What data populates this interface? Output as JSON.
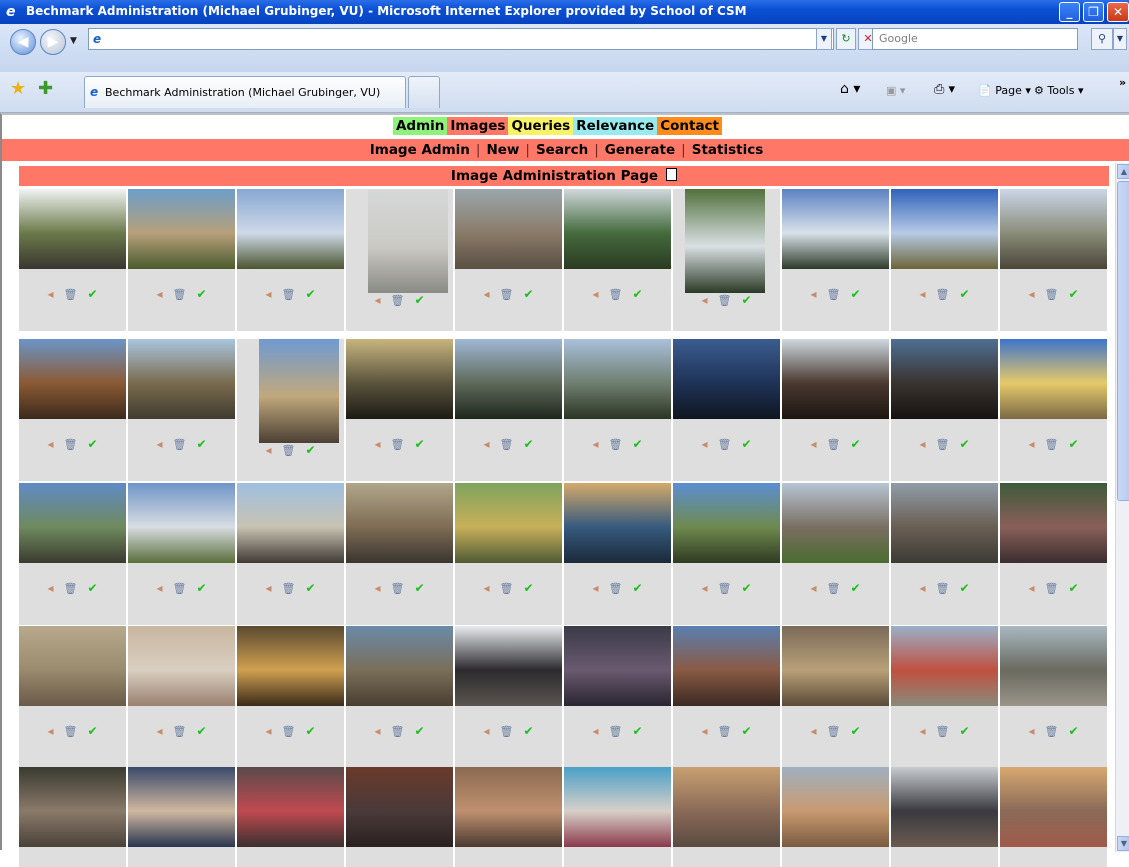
{
  "window": {
    "title": "Bechmark Administration (Michael Grubinger, VU) - Microsoft Internet Explorer provided by School of CSM"
  },
  "addressbar": {
    "url": "",
    "search_placeholder": "Google"
  },
  "tab": {
    "label": "Bechmark Administration (Michael Grubinger, VU)"
  },
  "toolbar": {
    "page_label": "Page",
    "tools_label": "Tools"
  },
  "nav": {
    "admin": "Admin",
    "images": "Images",
    "queries": "Queries",
    "relevance": "Relevance",
    "contact": "Contact"
  },
  "subnav": {
    "image_admin": "Image Admin",
    "new": "New",
    "search": "Search",
    "generate": "Generate",
    "statistics": "Statistics"
  },
  "page": {
    "heading": "Image Administration Page"
  },
  "colors": {
    "images_tab": "#ff7766",
    "admin_tab": "#8ef27a",
    "queries_tab": "#f7f266",
    "relevance_tab": "#99eaef",
    "contact_tab": "#ff8c1a",
    "cell_bg": "#dedede"
  },
  "icons": {
    "edit": "pencil-icon",
    "delete": "trash-icon",
    "ok": "checkmark-icon"
  },
  "images": [
    {
      "scene": "colonial-palace",
      "top": "#f1f3f4",
      "mid": "#6b7a4a",
      "bot": "#3a3530",
      "orient": "land"
    },
    {
      "scene": "colonial-street-palms",
      "top": "#6d9ec9",
      "mid": "#b6a07a",
      "bot": "#4b5b2d",
      "orient": "land"
    },
    {
      "scene": "christ-statue-hill",
      "top": "#87a7d2",
      "mid": "#cfd9e9",
      "bot": "#4a5530",
      "orient": "land"
    },
    {
      "scene": "white-statue",
      "top": "#d6d8d8",
      "mid": "#cbcac5",
      "bot": "#8b8b86",
      "orient": "portrait"
    },
    {
      "scene": "city-aerial",
      "top": "#9aa7ad",
      "mid": "#8a7a68",
      "bot": "#5a4f44",
      "orient": "land"
    },
    {
      "scene": "waterfalls",
      "top": "#d0d8dc",
      "mid": "#446b3d",
      "bot": "#2b3a22",
      "orient": "land"
    },
    {
      "scene": "waterfall-person",
      "top": "#52703c",
      "mid": "#d9e0e4",
      "bot": "#2b3a26",
      "orient": "portrait2"
    },
    {
      "scene": "waterfall-mist",
      "top": "#5c82c2",
      "mid": "#d9e2ea",
      "bot": "#2e3a2a",
      "orient": "land"
    },
    {
      "scene": "clouds-plain",
      "top": "#2f62b9",
      "mid": "#b7cbe6",
      "bot": "#6b6437",
      "orient": "land"
    },
    {
      "scene": "colonial-street-church",
      "top": "#cbd6e8",
      "mid": "#8a8d7a",
      "bot": "#4a4638",
      "orient": "land"
    },
    {
      "scene": "baroque-church",
      "top": "#6b95c8",
      "mid": "#8b5a34",
      "bot": "#3b2a1d",
      "orient": "land"
    },
    {
      "scene": "colonial-street",
      "top": "#a9c6df",
      "mid": "#7a6b4e",
      "bot": "#3f3b2f",
      "orient": "land"
    },
    {
      "scene": "church-towers",
      "top": "#6f9ad0",
      "mid": "#c1a87c",
      "bot": "#4b4035",
      "orient": "portrait"
    },
    {
      "scene": "sunset-river",
      "top": "#c7b57e",
      "mid": "#5a543d",
      "bot": "#1c1a12",
      "orient": "land"
    },
    {
      "scene": "dusk-fort",
      "top": "#9fb8d4",
      "mid": "#5f6a5a",
      "bot": "#1e261c",
      "orient": "land"
    },
    {
      "scene": "ship-dusk",
      "top": "#aac0db",
      "mid": "#6f7f70",
      "bot": "#2c3524",
      "orient": "land"
    },
    {
      "scene": "dusk-skyline",
      "top": "#3a5c8f",
      "mid": "#1f3358",
      "bot": "#0f1520",
      "orient": "land"
    },
    {
      "scene": "steam-train",
      "top": "#cfd9e0",
      "mid": "#4a3a30",
      "bot": "#1c1512",
      "orient": "land"
    },
    {
      "scene": "dark-courtyard",
      "top": "#4f6f94",
      "mid": "#3a3430",
      "bot": "#15120f",
      "orient": "land"
    },
    {
      "scene": "yellow-cathedral",
      "top": "#3f74c9",
      "mid": "#e6c96a",
      "bot": "#7a6a45",
      "orient": "land"
    },
    {
      "scene": "park-palace",
      "top": "#5f8bc5",
      "mid": "#6f8a5e",
      "bot": "#3b3b30",
      "orient": "land"
    },
    {
      "scene": "white-palace",
      "top": "#6f95c8",
      "mid": "#d8dde2",
      "bot": "#5a6e3a",
      "orient": "land"
    },
    {
      "scene": "modern-building",
      "top": "#9fc0e0",
      "mid": "#c8c2b2",
      "bot": "#3f3a33",
      "orient": "land"
    },
    {
      "scene": "busy-street",
      "top": "#b0a68a",
      "mid": "#7e6c54",
      "bot": "#3a3530",
      "orient": "land"
    },
    {
      "scene": "taxi-street",
      "top": "#7fa35d",
      "mid": "#c8b05a",
      "bot": "#4e5a34",
      "orient": "land"
    },
    {
      "scene": "rooftop-pool",
      "top": "#d4aa6a",
      "mid": "#365a7e",
      "bot": "#1b2a3a",
      "orient": "land"
    },
    {
      "scene": "flags-plaza",
      "top": "#5a8ed2",
      "mid": "#6f8a4e",
      "bot": "#2f3a22",
      "orient": "land"
    },
    {
      "scene": "dam-spillway",
      "top": "#b7c5d4",
      "mid": "#7a6f62",
      "bot": "#4b6b30",
      "orient": "land"
    },
    {
      "scene": "dam-wall",
      "top": "#8f9da8",
      "mid": "#6a5f54",
      "bot": "#3c3b35",
      "orient": "land"
    },
    {
      "scene": "crowd-people",
      "top": "#3e5a3a",
      "mid": "#8a5f5a",
      "bot": "#3a2e2e",
      "orient": "land"
    },
    {
      "scene": "dig-site",
      "top": "#b8a88c",
      "mid": "#9a8a6e",
      "bot": "#6a5a48",
      "orient": "land"
    },
    {
      "scene": "seated-group",
      "top": "#c9b6a0",
      "mid": "#d9cfc0",
      "bot": "#9a8070",
      "orient": "land"
    },
    {
      "scene": "concert-crowd",
      "top": "#5a4a30",
      "mid": "#d0a050",
      "bot": "#3a2a1a",
      "orient": "land"
    },
    {
      "scene": "outdoor-group",
      "top": "#6a8aa8",
      "mid": "#7a6f5a",
      "bot": "#4a3e30",
      "orient": "land"
    },
    {
      "scene": "group-photo",
      "top": "#e8ebef",
      "mid": "#2c2a2e",
      "bot": "#5a5550",
      "orient": "land"
    },
    {
      "scene": "children-group",
      "top": "#3a3a48",
      "mid": "#6a5a70",
      "bot": "#2a2530",
      "orient": "land"
    },
    {
      "scene": "school-building",
      "top": "#5a7fb0",
      "mid": "#8a5a44",
      "bot": "#3a2a22",
      "orient": "land"
    },
    {
      "scene": "construction",
      "top": "#7a6a58",
      "mid": "#b8a078",
      "bot": "#5a4a38",
      "orient": "land"
    },
    {
      "scene": "school-assembly",
      "top": "#9ab0c8",
      "mid": "#c05040",
      "bot": "#8a8a7a",
      "orient": "land"
    },
    {
      "scene": "schoolyard",
      "top": "#a8b8c0",
      "mid": "#6a6a60",
      "bot": "#9a9488",
      "orient": "land"
    },
    {
      "scene": "kids-closeup",
      "top": "#3a3a30",
      "mid": "#8a7a6a",
      "bot": "#4a4238",
      "orient": "land"
    },
    {
      "scene": "classroom-kids",
      "top": "#3a4a6a",
      "mid": "#d0b8a0",
      "bot": "#2a3550",
      "orient": "land"
    },
    {
      "scene": "women-gathering",
      "top": "#5a4a4a",
      "mid": "#c04a50",
      "bot": "#3a3030",
      "orient": "land"
    },
    {
      "scene": "indoor-meeting",
      "top": "#6a3a2a",
      "mid": "#4a3a3a",
      "bot": "#2a2020",
      "orient": "land"
    },
    {
      "scene": "crowded-class",
      "top": "#8a6a50",
      "mid": "#c09070",
      "bot": "#4a3a30",
      "orient": "land"
    },
    {
      "scene": "classroom-blue",
      "top": "#4aa0c8",
      "mid": "#d8d0c8",
      "bot": "#8a3a4a",
      "orient": "land"
    },
    {
      "scene": "kids-playing",
      "top": "#c8a070",
      "mid": "#8a6a58",
      "bot": "#5a4a40",
      "orient": "land"
    },
    {
      "scene": "smiling-boy",
      "top": "#a0b0c0",
      "mid": "#c89a70",
      "bot": "#7a5a40",
      "orient": "land"
    },
    {
      "scene": "teacher-class",
      "top": "#c8ccd0",
      "mid": "#3a3a40",
      "bot": "#6a5a50",
      "orient": "land"
    },
    {
      "scene": "classroom-desks",
      "top": "#d8a870",
      "mid": "#8a6a58",
      "bot": "#a05a4a",
      "orient": "land"
    }
  ]
}
